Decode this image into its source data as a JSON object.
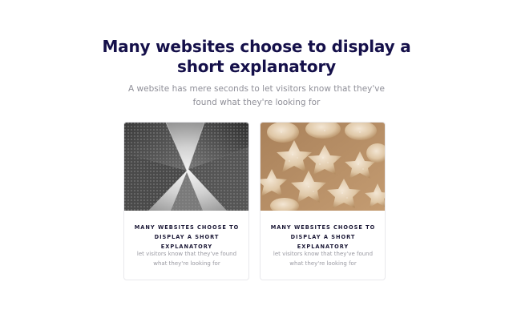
{
  "header": {
    "title": "Many websites choose to display a short explanatory",
    "subtitle": "A website has mere seconds to let visitors know that they've found what they're looking for"
  },
  "cards": [
    {
      "image": "skyscrapers-photo",
      "title": "MANY WEBSITES CHOOSE TO DISPLAY A SHORT EXPLANATORY",
      "text": "let visitors know that they've found what they're looking for"
    },
    {
      "image": "star-cookies-photo",
      "title": "MANY WEBSITES CHOOSE TO DISPLAY A SHORT EXPLANATORY",
      "text": "let visitors know that they've found what they're looking for"
    }
  ],
  "colors": {
    "heading": "#15104a",
    "subtext": "#8f8f98",
    "card_border": "#e8e8ec"
  }
}
